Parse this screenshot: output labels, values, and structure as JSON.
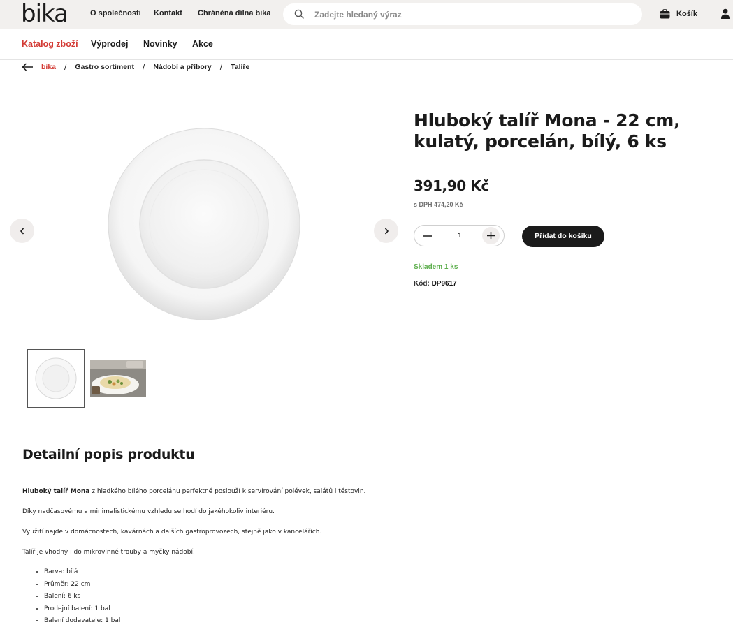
{
  "header": {
    "logo": "bika",
    "links": [
      "O společnosti",
      "Kontakt",
      "Chráněná dílna bika"
    ],
    "search_placeholder": "Zadejte hledaný výraz",
    "cart_label": "Košík"
  },
  "nav": {
    "items": [
      "Katalog zboží",
      "Výprodej",
      "Novinky",
      "Akce"
    ]
  },
  "breadcrumb": [
    "bika",
    "Gastro sortiment",
    "Nádobí a příbory",
    "Talíře"
  ],
  "product": {
    "title": "Hluboký talíř Mona - 22 cm, kulatý, porcelán, bílý, 6 ks",
    "price": "391,90 Kč",
    "price_vat": "s DPH 474,20 Kč",
    "quantity": "1",
    "add_to_cart": "Přidat do košíku",
    "stock": "Skladem 1 ks",
    "code_label": "Kód:",
    "code": "DP9617"
  },
  "description": {
    "title": "Detailní popis produktu",
    "p1_bold": "Hluboký talíř Mona",
    "p1_rest": " z hladkého bílého porcelánu perfektně poslouží k servírování polévek, salátů i těstovin.",
    "p2": "Díky nadčasovému a minimalistickému vzhledu se hodí do jakéhokoliv interiéru.",
    "p3": "Využití najde v domácnostech, kavárnách a dalších gastroprovozech, stejně jako v kancelářích.",
    "p4": "Talíř je vhodný i do mikrovlnné trouby a myčky nádobí.",
    "bullets": [
      "Barva: bílá",
      "Průměr: 22 cm",
      "Balení: 6 ks",
      "Prodejní balení: 1 bal",
      "Balení dodavatele: 1 bal"
    ]
  },
  "icons": {
    "search": "search-icon",
    "cart": "bag-icon",
    "user": "user-icon",
    "back": "arrow-left-icon",
    "prev": "chevron-left-icon",
    "next": "chevron-right-icon",
    "minus": "minus-icon",
    "plus": "plus-icon"
  },
  "colors": {
    "accent": "#d33b35",
    "stock": "#5cae4c",
    "button": "#1b1b1b",
    "topbar": "#f2f0ee"
  }
}
